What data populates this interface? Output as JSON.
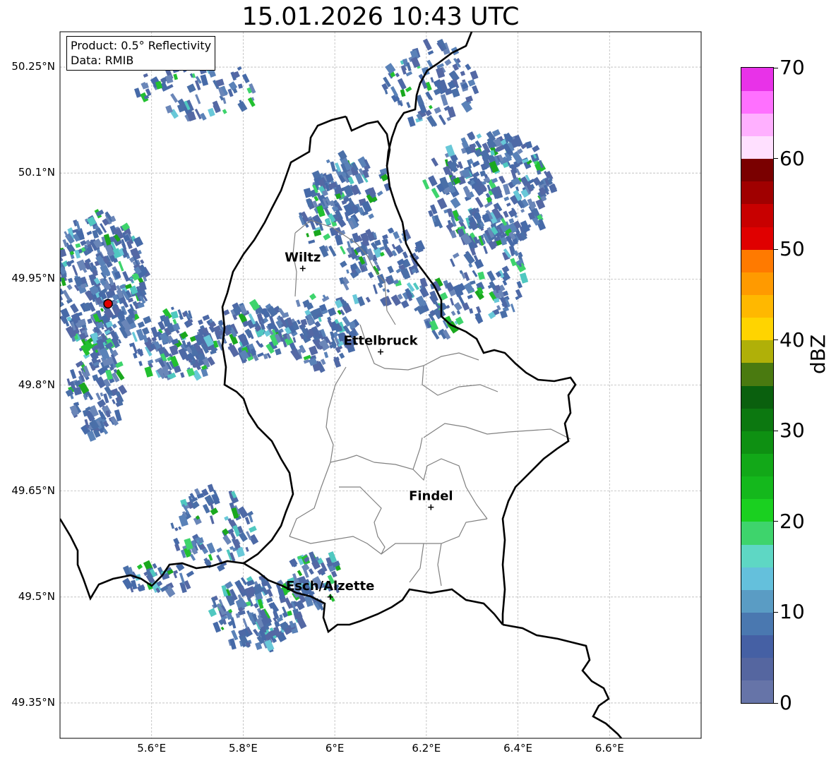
{
  "title": "15.01.2026 10:43 UTC",
  "info": {
    "product": "Product: 0.5° Reflectivity",
    "source": "Data: RMIB"
  },
  "lat_ticks": [
    "50.25°N",
    "50.1°N",
    "49.95°N",
    "49.8°N",
    "49.65°N",
    "49.5°N",
    "49.35°N"
  ],
  "lon_ticks": [
    "5.6°E",
    "5.8°E",
    "6°E",
    "6.2°E",
    "6.4°E",
    "6.6°E"
  ],
  "cities": [
    {
      "name": "Wiltz",
      "lon": 5.93,
      "lat": 49.965
    },
    {
      "name": "Ettelbruck",
      "lon": 6.1,
      "lat": 49.847
    },
    {
      "name": "Findel",
      "lon": 6.21,
      "lat": 49.627
    },
    {
      "name": "Esch/Alzette",
      "lon": 5.99,
      "lat": 49.5
    }
  ],
  "radar_site": {
    "lon": 5.505,
    "lat": 49.915,
    "color": "#e00000"
  },
  "extent": {
    "lon_min": 5.4,
    "lon_max": 6.8,
    "lat_min": 49.3,
    "lat_max": 50.3
  },
  "colorbar": {
    "label": "dBZ",
    "ticks": [
      "0",
      "10",
      "20",
      "30",
      "40",
      "50",
      "60",
      "70"
    ],
    "min": 0,
    "max": 70,
    "colors": [
      "#6674a8",
      "#5566a0",
      "#4560a4",
      "#4a78b0",
      "#5a9cc4",
      "#64c0dc",
      "#5ed7c4",
      "#3ed46c",
      "#1ad020",
      "#14b81c",
      "#12a818",
      "#0e9012",
      "#0c7810",
      "#0a600e",
      "#4a7a10",
      "#b0b008",
      "#ffd400",
      "#ffb800",
      "#ff9a00",
      "#ff7a00",
      "#e00000",
      "#c80000",
      "#a00000",
      "#7a0000",
      "#ffe0ff",
      "#ffb0ff",
      "#ff70ff",
      "#e832e8"
    ]
  }
}
